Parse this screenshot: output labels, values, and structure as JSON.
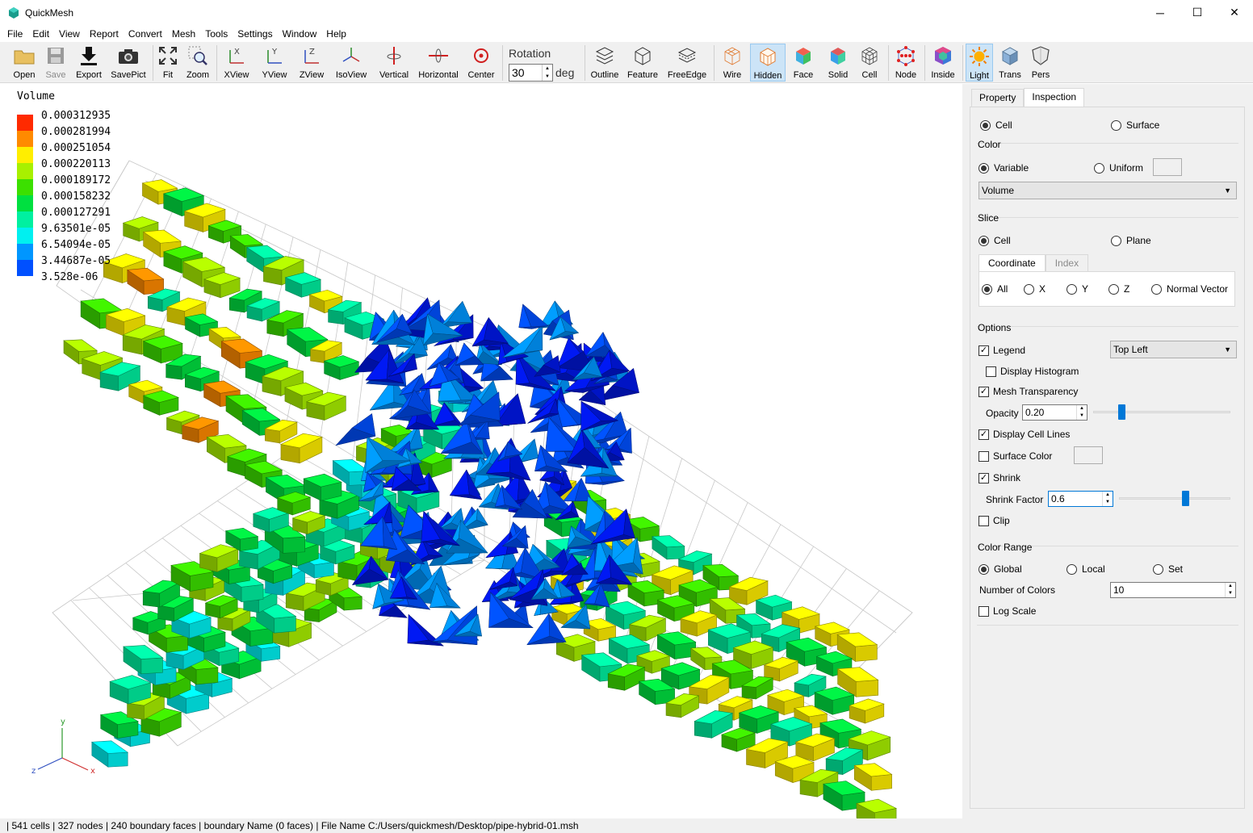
{
  "window": {
    "title": "QuickMesh",
    "minimize": "─",
    "maximize": "☐",
    "close": "✕"
  },
  "menu": [
    "File",
    "Edit",
    "View",
    "Report",
    "Convert",
    "Mesh",
    "Tools",
    "Settings",
    "Window",
    "Help"
  ],
  "toolbar": {
    "open": "Open",
    "save": "Save",
    "export": "Export",
    "savepict": "SavePict",
    "fit": "Fit",
    "zoom": "Zoom",
    "xview": "XView",
    "yview": "YView",
    "zview": "ZView",
    "isoview": "IsoView",
    "vertical": "Vertical",
    "horizontal": "Horizontal",
    "center": "Center",
    "rotation_label": "Rotation",
    "rotation_value": "30",
    "rotation_unit": "deg",
    "outline": "Outline",
    "feature": "Feature",
    "freeedge": "FreeEdge",
    "wire": "Wire",
    "hidden": "Hidden",
    "face": "Face",
    "solid": "Solid",
    "cell": "Cell",
    "node": "Node",
    "inside": "Inside",
    "light": "Light",
    "trans": "Trans",
    "pers": "Pers"
  },
  "legend": {
    "title": "Volume",
    "entries": [
      {
        "value": "0.000312935",
        "color": "#ff2a00"
      },
      {
        "value": "0.000281994",
        "color": "#ff8a00"
      },
      {
        "value": "0.000251054",
        "color": "#ffee00"
      },
      {
        "value": "0.000220113",
        "color": "#a8f000"
      },
      {
        "value": "0.000189172",
        "color": "#3ce000"
      },
      {
        "value": "0.000158232",
        "color": "#00e040"
      },
      {
        "value": "0.000127291",
        "color": "#00f0a0"
      },
      {
        "value": "9.63501e-05",
        "color": "#00f0f0"
      },
      {
        "value": "6.54094e-05",
        "color": "#0096ff"
      },
      {
        "value": "3.44687e-05",
        "color": "#0050ff"
      },
      {
        "value": "3.528e-06",
        "color": "#0018e8"
      }
    ]
  },
  "axis": {
    "y": "y",
    "x": "x",
    "z": "z"
  },
  "panel": {
    "tabs": [
      "Property",
      "Inspection"
    ],
    "mode": {
      "cell": "Cell",
      "surface": "Surface"
    },
    "color": {
      "title": "Color",
      "variable": "Variable",
      "uniform": "Uniform",
      "variable_value": "Volume"
    },
    "slice": {
      "title": "Slice",
      "cell": "Cell",
      "plane": "Plane",
      "subtabs": [
        "Coordinate",
        "Index"
      ],
      "options": [
        "All",
        "X",
        "Y",
        "Z",
        "Normal Vector"
      ]
    },
    "options": {
      "title": "Options",
      "legend": "Legend",
      "legend_position": "Top Left",
      "display_histogram": "Display Histogram",
      "mesh_transparency": "Mesh Transparency",
      "opacity_label": "Opacity",
      "opacity_value": "0.20",
      "display_cell_lines": "Display Cell Lines",
      "surface_color": "Surface Color",
      "shrink": "Shrink",
      "shrink_factor_label": "Shrink Factor",
      "shrink_factor_value": "0.6",
      "clip": "Clip"
    },
    "color_range": {
      "title": "Color Range",
      "global": "Global",
      "local": "Local",
      "set": "Set",
      "num_colors_label": "Number of Colors",
      "num_colors_value": "10",
      "log_scale": "Log Scale"
    }
  },
  "status": "| 541 cells | 327 nodes | 240 boundary faces |  boundary Name  (0 faces) | File Name C:/Users/quickmesh/Desktop/pipe-hybrid-01.msh"
}
